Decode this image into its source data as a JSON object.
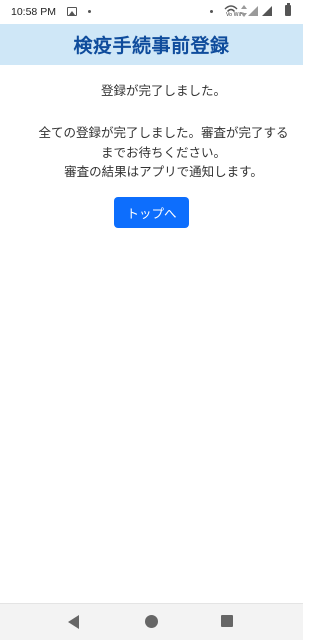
{
  "status_bar": {
    "time": "10:58 PM",
    "vowifi_label": "Vo WiFi",
    "icons": [
      "photo-icon",
      "notification-dot-icon",
      "wifi-icon",
      "data-arrows-icon",
      "signal-icon",
      "signal-icon",
      "battery-icon"
    ]
  },
  "header": {
    "title": "検疫手続事前登録",
    "background": "#cfe7f7",
    "title_color": "#0f4c9c"
  },
  "main": {
    "complete_message": "登録が完了しました。",
    "detail_lines": [
      "全ての登録が完了しました。審査が完了する",
      "までお待ちください。",
      "審査の結果はアプリで通知します。"
    ],
    "top_button_label": "トップへ",
    "button_color": "#0d6efd"
  },
  "nav_bar": {
    "buttons": [
      "back-icon",
      "home-icon",
      "recents-icon"
    ]
  }
}
